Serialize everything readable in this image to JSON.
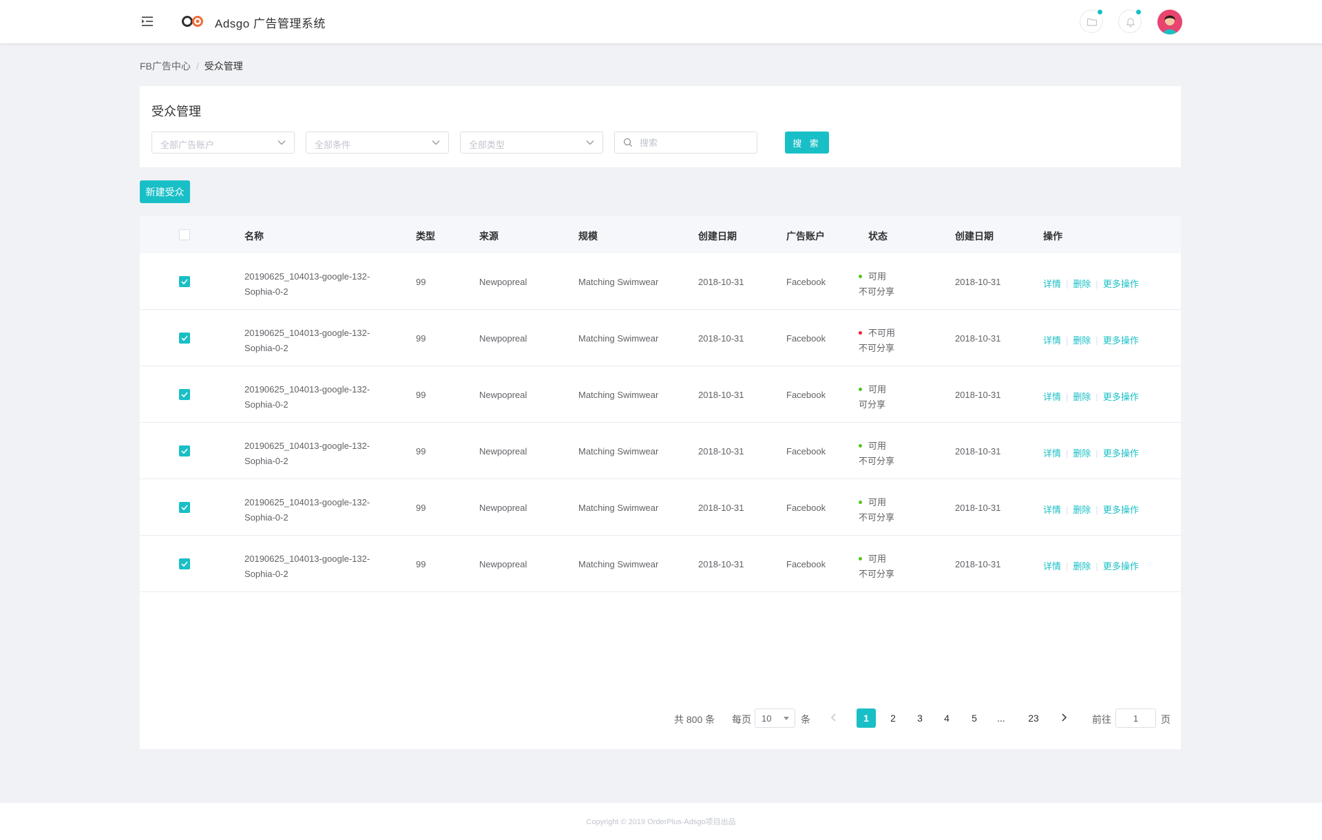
{
  "header": {
    "app_title": "Adsgo 广告管理系统",
    "icons": [
      "menu-fold-icon",
      "logo",
      "folder-icon",
      "bell-icon",
      "avatar"
    ],
    "accent_color": "#19bfc6",
    "badge_color": "#19bfc6"
  },
  "breadcrumb": {
    "parent": "FB广告中心",
    "separator": "/",
    "current": "受众管理"
  },
  "filters": {
    "title": "受众管理",
    "ad_account_placeholder": "全部广告账户",
    "condition_placeholder": "全部条件",
    "type_placeholder": "全部类型",
    "search_placeholder": "搜索",
    "search_button": "搜 索"
  },
  "actions": {
    "new_audience": "新建受众"
  },
  "table": {
    "columns": [
      "名称",
      "类型",
      "来源",
      "规模",
      "创建日期",
      "广告账户",
      "状态",
      "创建日期",
      "操作"
    ],
    "header_checked": false,
    "rows": [
      {
        "checked": true,
        "name": "20190625_104013-google-132-Sophia-0-2",
        "type": "99",
        "source": "Newpopreal",
        "scale": "Matching Swimwear",
        "created": "2018-10-31",
        "account": "Facebook",
        "status": "可用",
        "status_color": "#52c41a",
        "share": "不可分享",
        "created2": "2018-10-31"
      },
      {
        "checked": true,
        "name": "20190625_104013-google-132-Sophia-0-2",
        "type": "99",
        "source": "Newpopreal",
        "scale": "Matching Swimwear",
        "created": "2018-10-31",
        "account": "Facebook",
        "status": "不可用",
        "status_color": "#f5222d",
        "share": "不可分享",
        "created2": "2018-10-31"
      },
      {
        "checked": true,
        "name": "20190625_104013-google-132-Sophia-0-2",
        "type": "99",
        "source": "Newpopreal",
        "scale": "Matching Swimwear",
        "created": "2018-10-31",
        "account": "Facebook",
        "status": "可用",
        "status_color": "#52c41a",
        "share": "可分享",
        "created2": "2018-10-31"
      },
      {
        "checked": true,
        "name": "20190625_104013-google-132-Sophia-0-2",
        "type": "99",
        "source": "Newpopreal",
        "scale": "Matching Swimwear",
        "created": "2018-10-31",
        "account": "Facebook",
        "status": "可用",
        "status_color": "#52c41a",
        "share": "不可分享",
        "created2": "2018-10-31"
      },
      {
        "checked": true,
        "name": "20190625_104013-google-132-Sophia-0-2",
        "type": "99",
        "source": "Newpopreal",
        "scale": "Matching Swimwear",
        "created": "2018-10-31",
        "account": "Facebook",
        "status": "可用",
        "status_color": "#52c41a",
        "share": "不可分享",
        "created2": "2018-10-31"
      },
      {
        "checked": true,
        "name": "20190625_104013-google-132-Sophia-0-2",
        "type": "99",
        "source": "Newpopreal",
        "scale": "Matching Swimwear",
        "created": "2018-10-31",
        "account": "Facebook",
        "status": "可用",
        "status_color": "#52c41a",
        "share": "不可分享",
        "created2": "2018-10-31"
      }
    ],
    "ops": {
      "detail": "详情",
      "delete": "删除",
      "more": "更多操作"
    }
  },
  "pagination": {
    "total_text": "共 800 条",
    "per_page_label": "每页",
    "per_page_value": "10",
    "per_page_unit": "条",
    "pages": [
      "1",
      "2",
      "3",
      "4",
      "5",
      "...",
      "23"
    ],
    "current_page": "1",
    "goto_label": "前往",
    "goto_value": "1",
    "goto_unit": "页"
  },
  "footer": {
    "copyright": "Copyright © 2019 OrderPlus-Adsgo项目出品"
  }
}
